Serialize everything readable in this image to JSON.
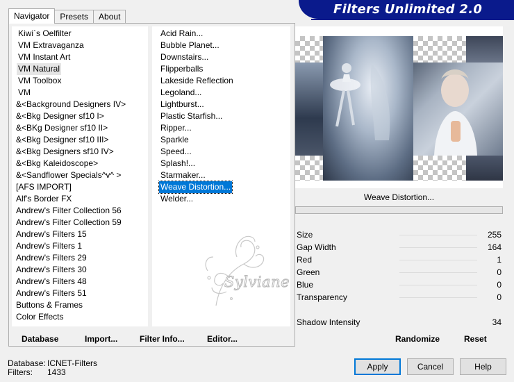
{
  "tabs": [
    {
      "label": "Navigator",
      "active": true
    },
    {
      "label": "Presets",
      "active": false
    },
    {
      "label": "About",
      "active": false
    }
  ],
  "banner": {
    "title": "Filters Unlimited 2.0"
  },
  "categories": [
    {
      "label": "Kiwi`s Oelfilter",
      "selected": false
    },
    {
      "label": "VM Extravaganza",
      "selected": false
    },
    {
      "label": "VM Instant Art",
      "selected": false
    },
    {
      "label": "VM Natural",
      "selected": true
    },
    {
      "label": "VM Toolbox",
      "selected": false
    },
    {
      "label": "VM",
      "selected": false
    },
    {
      "label": "&<Background Designers IV>",
      "selected": false
    },
    {
      "label": "&<Bkg Designer sf10 I>",
      "selected": false
    },
    {
      "label": "&<BKg Designer sf10 II>",
      "selected": false
    },
    {
      "label": "&<Bkg Designer sf10 III>",
      "selected": false
    },
    {
      "label": "&<Bkg Designers sf10 IV>",
      "selected": false
    },
    {
      "label": "&<Bkg Kaleidoscope>",
      "selected": false
    },
    {
      "label": "&<Sandflower Specials^v^ >",
      "selected": false
    },
    {
      "label": "[AFS IMPORT]",
      "selected": false
    },
    {
      "label": "Alf's Border FX",
      "selected": false
    },
    {
      "label": "Andrew's Filter Collection 56",
      "selected": false
    },
    {
      "label": "Andrew's Filter Collection 59",
      "selected": false
    },
    {
      "label": "Andrew's Filters 15",
      "selected": false
    },
    {
      "label": "Andrew's Filters 1",
      "selected": false
    },
    {
      "label": "Andrew's Filters 29",
      "selected": false
    },
    {
      "label": "Andrew's Filters 30",
      "selected": false
    },
    {
      "label": "Andrew's Filters 48",
      "selected": false
    },
    {
      "label": "Andrew's Filters 51",
      "selected": false
    },
    {
      "label": "Buttons & Frames",
      "selected": false
    },
    {
      "label": "Color Effects",
      "selected": false
    }
  ],
  "filters": [
    {
      "label": "Acid Rain...",
      "selected": false
    },
    {
      "label": "Bubble Planet...",
      "selected": false
    },
    {
      "label": "Downstairs...",
      "selected": false
    },
    {
      "label": "Flipperballs",
      "selected": false
    },
    {
      "label": "Lakeside Reflection",
      "selected": false
    },
    {
      "label": "Legoland...",
      "selected": false
    },
    {
      "label": "Lightburst...",
      "selected": false
    },
    {
      "label": "Plastic Starfish...",
      "selected": false
    },
    {
      "label": "Ripper...",
      "selected": false
    },
    {
      "label": "Sparkle",
      "selected": false
    },
    {
      "label": "Speed...",
      "selected": false
    },
    {
      "label": "Splash!...",
      "selected": false
    },
    {
      "label": "Starmaker...",
      "selected": false
    },
    {
      "label": "Weave Distortion...",
      "selected": true
    },
    {
      "label": "Welder...",
      "selected": false
    }
  ],
  "watermark": {
    "text": "Sylviane"
  },
  "actions": {
    "database": "Database",
    "import": "Import...",
    "filter_info": "Filter Info...",
    "editor": "Editor...",
    "randomize": "Randomize",
    "reset": "Reset"
  },
  "filter_name": "Weave Distortion...",
  "params": [
    {
      "name": "Size",
      "value": "255",
      "level": 1.0
    },
    {
      "name": "Gap Width",
      "value": "164",
      "level": 0.643
    },
    {
      "name": "Red",
      "value": "1",
      "level": 0.004
    },
    {
      "name": "Green",
      "value": "0",
      "level": 0
    },
    {
      "name": "Blue",
      "value": "0",
      "level": 0
    },
    {
      "name": "Transparency",
      "value": "0",
      "level": 0
    }
  ],
  "shadow": {
    "name": "Shadow Intensity",
    "value": "34"
  },
  "status": {
    "database_label": "Database:",
    "database_value": "ICNET-Filters",
    "filters_label": "Filters:",
    "filters_value": "1433"
  },
  "buttons": {
    "apply": "Apply",
    "cancel": "Cancel",
    "help": "Help"
  },
  "colors": {
    "banner": "#0a1a8c",
    "selection": "#0078d7"
  }
}
